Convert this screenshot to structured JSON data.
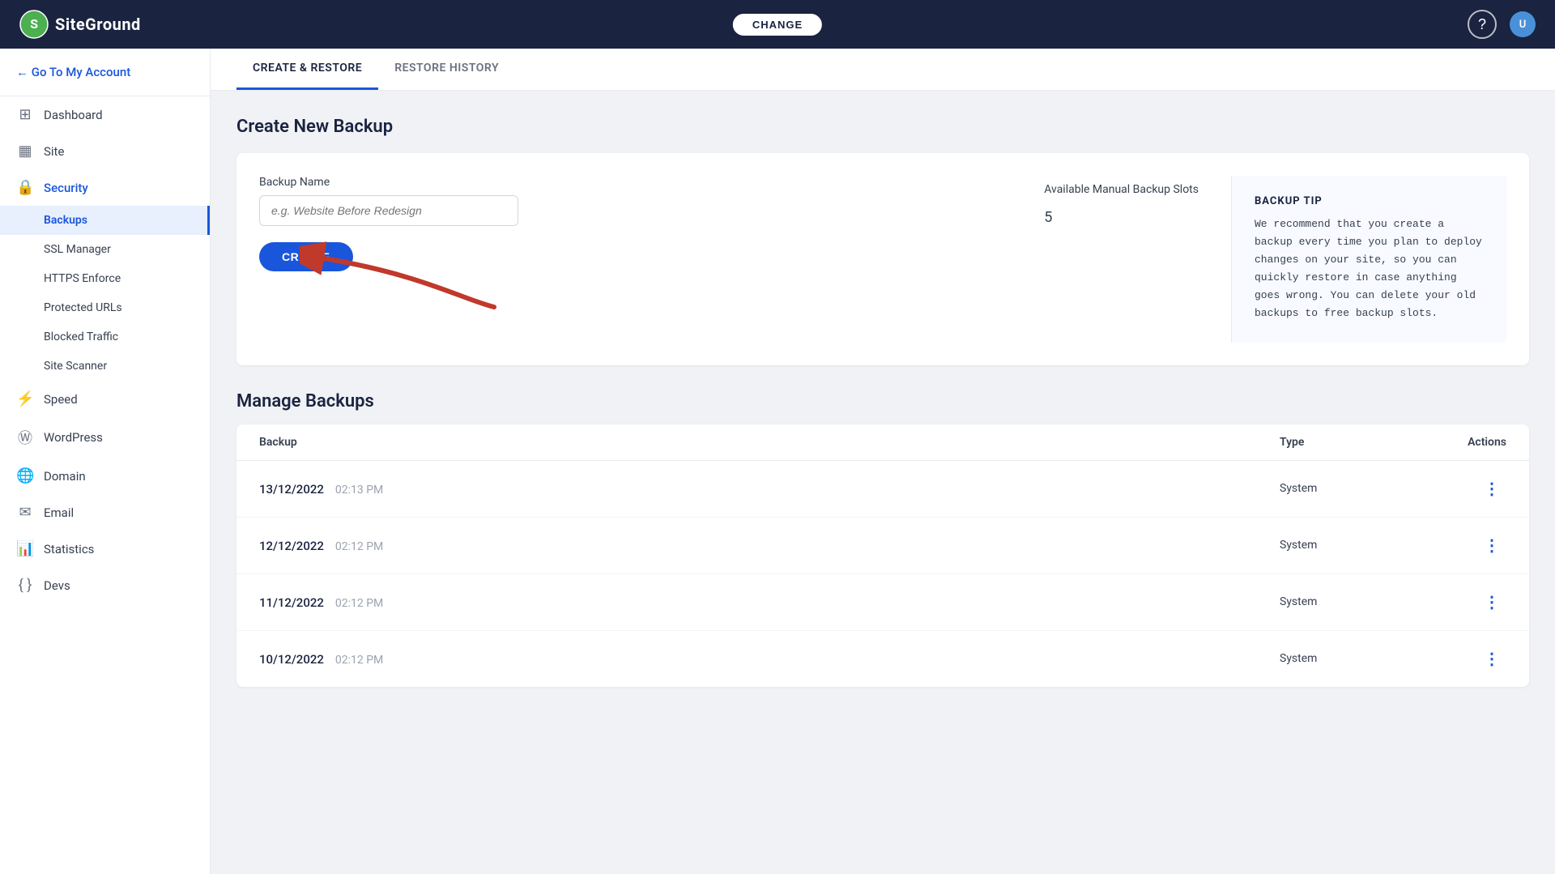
{
  "header": {
    "logo_text": "SiteGround",
    "change_label": "CHANGE",
    "help_title": "?",
    "avatar_initials": "U"
  },
  "sidebar": {
    "go_to_account": "← Go To My Account",
    "items": [
      {
        "id": "dashboard",
        "label": "Dashboard",
        "icon": "⊞"
      },
      {
        "id": "site",
        "label": "Site",
        "icon": "▦"
      },
      {
        "id": "security",
        "label": "Security",
        "icon": "🔒",
        "active": true,
        "sub": [
          {
            "id": "backups",
            "label": "Backups",
            "active": true
          },
          {
            "id": "ssl-manager",
            "label": "SSL Manager",
            "active": false
          },
          {
            "id": "https-enforce",
            "label": "HTTPS Enforce",
            "active": false
          },
          {
            "id": "protected-urls",
            "label": "Protected URLs",
            "active": false
          },
          {
            "id": "blocked-traffic",
            "label": "Blocked Traffic",
            "active": false
          },
          {
            "id": "site-scanner",
            "label": "Site Scanner",
            "active": false
          }
        ]
      },
      {
        "id": "speed",
        "label": "Speed",
        "icon": "⚡"
      },
      {
        "id": "wordpress",
        "label": "WordPress",
        "icon": "Ⓦ"
      },
      {
        "id": "domain",
        "label": "Domain",
        "icon": "🌐"
      },
      {
        "id": "email",
        "label": "Email",
        "icon": "✉"
      },
      {
        "id": "statistics",
        "label": "Statistics",
        "icon": "📊"
      },
      {
        "id": "devs",
        "label": "Devs",
        "icon": "{ }"
      }
    ]
  },
  "tabs": [
    {
      "id": "create-restore",
      "label": "CREATE & RESTORE",
      "active": true
    },
    {
      "id": "restore-history",
      "label": "RESTORE HISTORY",
      "active": false
    }
  ],
  "create_section": {
    "title": "Create New Backup",
    "form": {
      "backup_name_label": "Backup Name",
      "backup_name_placeholder": "e.g. Website Before Redesign",
      "slots_label": "Available Manual Backup Slots",
      "slots_value": "5",
      "create_button": "CREATE"
    },
    "tip": {
      "title": "BACKUP TIP",
      "text": "We recommend that you create a backup every time you plan to deploy changes on your site, so you can quickly restore in case anything goes wrong. You can delete your old backups to free backup slots."
    }
  },
  "manage_section": {
    "title": "Manage Backups",
    "table": {
      "columns": [
        "Backup",
        "Type",
        "Actions"
      ],
      "rows": [
        {
          "date": "13/12/2022",
          "time": "02:13 PM",
          "type": "System"
        },
        {
          "date": "12/12/2022",
          "time": "02:12 PM",
          "type": "System"
        },
        {
          "date": "11/12/2022",
          "time": "02:12 PM",
          "type": "System"
        },
        {
          "date": "10/12/2022",
          "time": "02:12 PM",
          "type": "System"
        }
      ]
    }
  }
}
